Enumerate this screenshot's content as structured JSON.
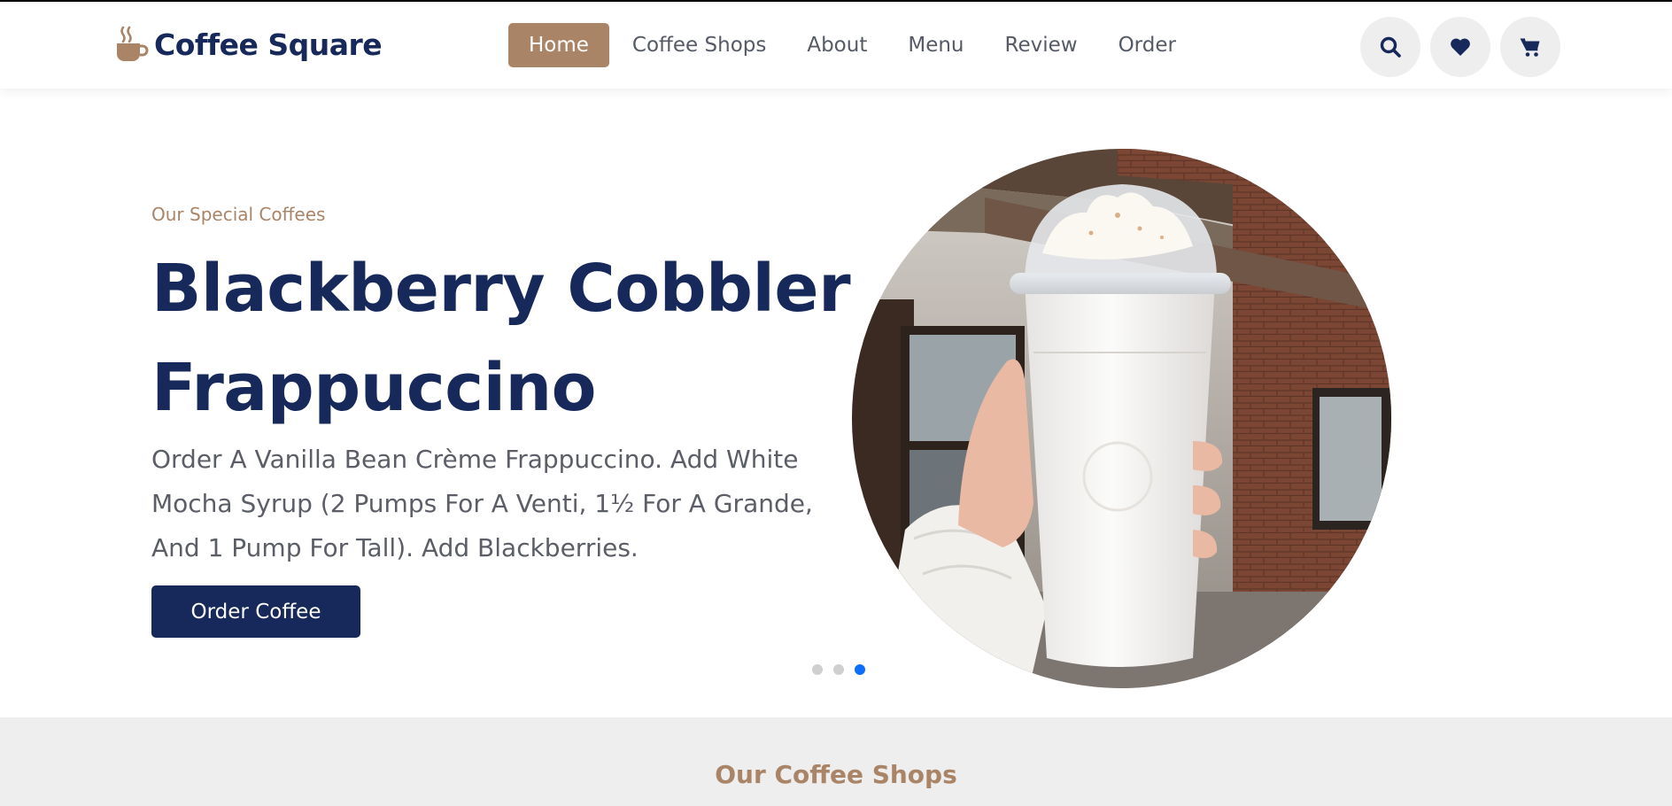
{
  "brand": {
    "name": "Coffee Square",
    "icon": "coffee-cup-icon"
  },
  "nav": {
    "items": [
      {
        "label": "Home",
        "active": true
      },
      {
        "label": "Coffee Shops"
      },
      {
        "label": "About"
      },
      {
        "label": "Menu"
      },
      {
        "label": "Review"
      },
      {
        "label": "Order"
      }
    ]
  },
  "actions": [
    {
      "icon": "search-icon"
    },
    {
      "icon": "heart-icon"
    },
    {
      "icon": "cart-icon"
    }
  ],
  "hero": {
    "eyebrow": "Our Special Coffees",
    "title_line1": "Blackberry Cobbler",
    "title_line2": "Frappuccino",
    "description": "Order A Vanilla Bean Crème Frappuccino. Add White Mocha Syrup (2 Pumps For A Venti, 1½ For A Grande, And 1 Pump For Tall). Add Blackberries.",
    "cta_label": "Order Coffee",
    "slides_total": 3,
    "active_slide": 3
  },
  "shops": {
    "heading": "Our Coffee Shops"
  },
  "colors": {
    "navy": "#17295a",
    "accent": "#a98467",
    "text_gray": "#5b5e66",
    "dot_active": "#0d6efd"
  }
}
